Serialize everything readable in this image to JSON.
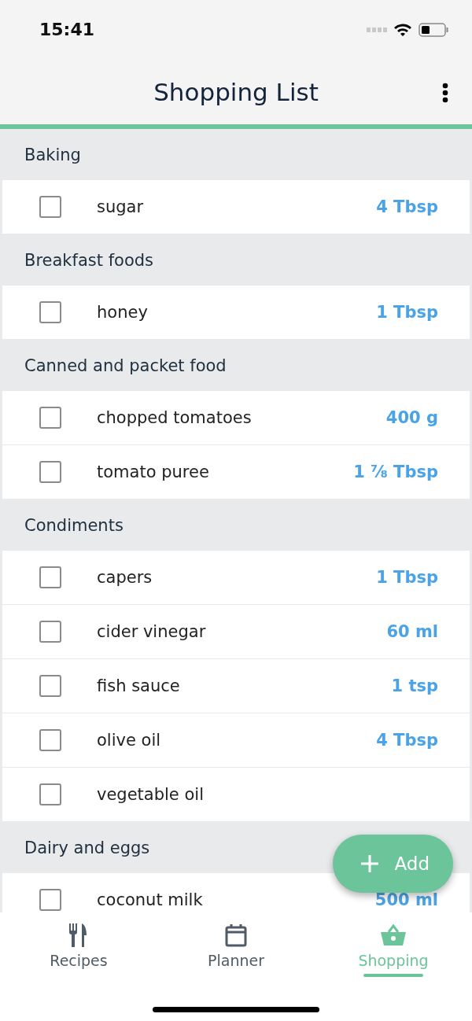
{
  "status_bar": {
    "time": "15:41"
  },
  "header": {
    "title": "Shopping List"
  },
  "sections": [
    {
      "title": "Baking",
      "items": [
        {
          "name": "sugar",
          "amount": "4 Tbsp",
          "checked": false
        }
      ]
    },
    {
      "title": "Breakfast foods",
      "items": [
        {
          "name": "honey",
          "amount": "1 Tbsp",
          "checked": false
        }
      ]
    },
    {
      "title": "Canned and packet food",
      "items": [
        {
          "name": "chopped tomatoes",
          "amount": "400 g",
          "checked": false
        },
        {
          "name": "tomato puree",
          "amount": "1 ⅞ Tbsp",
          "checked": false
        }
      ]
    },
    {
      "title": "Condiments",
      "items": [
        {
          "name": "capers",
          "amount": "1 Tbsp",
          "checked": false
        },
        {
          "name": "cider vinegar",
          "amount": "60 ml",
          "checked": false
        },
        {
          "name": "fish sauce",
          "amount": "1 tsp",
          "checked": false
        },
        {
          "name": "olive oil",
          "amount": "4 Tbsp",
          "checked": false
        },
        {
          "name": "vegetable oil",
          "checked": false
        }
      ]
    },
    {
      "title": "Dairy and eggs",
      "items": [
        {
          "name": "coconut milk",
          "amount": "500 ml",
          "checked": false
        }
      ]
    }
  ],
  "add_button": {
    "label": "Add"
  },
  "tabs": [
    {
      "label": "Recipes",
      "kind": "recipes",
      "selected": false
    },
    {
      "label": "Planner",
      "kind": "planner",
      "selected": false
    },
    {
      "label": "Shopping",
      "kind": "shopping",
      "selected": true
    }
  ]
}
